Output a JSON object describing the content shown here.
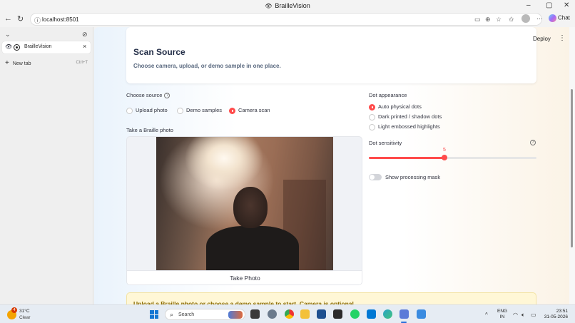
{
  "window": {
    "title": "BrailleVision",
    "controls": {
      "minimize": "–",
      "maximize": "▢",
      "close": "✕"
    }
  },
  "browser": {
    "back": "←",
    "reload": "↻",
    "url": "localhost:8501",
    "info_icon": "ⓘ",
    "toolbar_icons": [
      "camera-icon",
      "zoom-icon",
      "star-icon",
      "favorites-icon",
      "profile-icon",
      "more-icon"
    ],
    "more_glyph": "···",
    "chat_label": "Chat"
  },
  "tabs": {
    "collapse_glyph": "⌄",
    "pin_glyph": "⊘",
    "active_tab": {
      "label": "BrailleVision",
      "close": "×"
    },
    "new_tab": {
      "label": "New tab",
      "shortcut": "Ctrl+T",
      "plus": "+"
    }
  },
  "app": {
    "deploy_label": "Deploy",
    "menu_glyph": "⋮",
    "header": {
      "title": "Scan Source",
      "subtitle": "Choose camera, upload, or demo sample in one place."
    },
    "choose_source": {
      "label": "Choose source",
      "help": "?",
      "options": [
        "Upload photo",
        "Demo samples",
        "Camera scan"
      ],
      "selected": "Camera scan"
    },
    "camera": {
      "label": "Take a Braille photo",
      "button": "Take Photo"
    },
    "dot_appearance": {
      "label": "Dot appearance",
      "options": [
        "Auto physical dots",
        "Dark printed / shadow dots",
        "Light embossed highlights"
      ],
      "selected": "Auto physical dots"
    },
    "dot_sensitivity": {
      "label": "Dot sensitivity",
      "help": "?",
      "value": "5",
      "fraction": 0.45
    },
    "processing_mask": {
      "label": "Show processing mask",
      "on": false
    },
    "notice": "Upload a Braille photo or choose a demo sample to start. Camera is optional."
  },
  "taskbar": {
    "weather": {
      "temp": "31°C",
      "condition": "Clear",
      "badge": "4"
    },
    "search_placeholder": "Search",
    "tray_chevron": "^",
    "lang_line1": "ENG",
    "lang_line2": "IN",
    "time": "23:51",
    "date": "31-05-2026",
    "accent": "#ff4b4b"
  }
}
